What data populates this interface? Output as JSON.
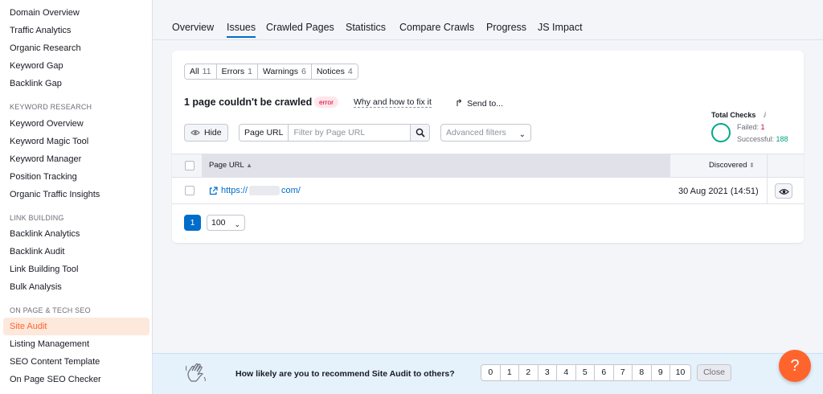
{
  "sidebar": {
    "items_top": [
      "Domain Overview",
      "Traffic Analytics",
      "Organic Research",
      "Keyword Gap",
      "Backlink Gap"
    ],
    "section_keyword": "KEYWORD RESEARCH",
    "items_keyword": [
      "Keyword Overview",
      "Keyword Magic Tool",
      "Keyword Manager",
      "Position Tracking",
      "Organic Traffic Insights"
    ],
    "section_link": "LINK BUILDING",
    "items_link": [
      "Backlink Analytics",
      "Backlink Audit",
      "Link Building Tool",
      "Bulk Analysis"
    ],
    "section_onpage": "ON PAGE & TECH SEO",
    "items_onpage": [
      "Site Audit",
      "Listing Management",
      "SEO Content Template",
      "On Page SEO Checker"
    ],
    "active_item": "Site Audit"
  },
  "tabs": [
    "Overview",
    "Issues",
    "Crawled Pages",
    "Statistics",
    "Compare Crawls",
    "Progress",
    "JS Impact"
  ],
  "active_tab": "Issues",
  "filters": [
    {
      "label": "All",
      "count": "11"
    },
    {
      "label": "Errors",
      "count": "1"
    },
    {
      "label": "Warnings",
      "count": "6"
    },
    {
      "label": "Notices",
      "count": "4"
    }
  ],
  "issue": {
    "title": "1 page couldn't be crawled",
    "badge": "error",
    "why_link": "Why and how to fix it",
    "send_to": "Send to..."
  },
  "total_checks": {
    "title": "Total Checks",
    "info_icon": "info-icon",
    "failed_label": "Failed:",
    "failed_value": "1",
    "successful_label": "Successful:",
    "successful_value": "188"
  },
  "toolbar": {
    "hide_label": "Hide",
    "page_url_label": "Page URL",
    "filter_placeholder": "Filter by Page URL",
    "advanced_filters": "Advanced filters"
  },
  "table": {
    "col_url": "Page URL",
    "col_discovered": "Discovered",
    "rows": [
      {
        "url_start": "https://",
        "url_end": "com/",
        "discovered": "30 Aug 2021 (14:51)"
      }
    ]
  },
  "pagination": {
    "current_page": "1",
    "per_page": "100"
  },
  "feedback": {
    "question": "How likely are you to recommend Site Audit to others?",
    "scale": [
      "0",
      "1",
      "2",
      "3",
      "4",
      "5",
      "6",
      "7",
      "8",
      "9",
      "10"
    ],
    "close_label": "Close"
  },
  "help_label": "?",
  "colors": {
    "brand": "#ff642d",
    "accent": "#006dca",
    "success": "#00a88a",
    "error": "#d1002f"
  }
}
